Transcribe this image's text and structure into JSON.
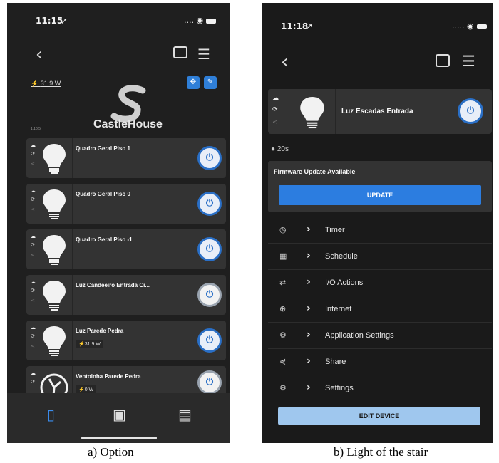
{
  "phone_a": {
    "status_time": "11:15",
    "status_right": "....",
    "power_reading": "31.9 W",
    "logo_text": "CastleHouse",
    "version": "1.10.5",
    "devices": [
      {
        "name": "Quadro Geral Piso 1",
        "watt": "",
        "state": "on"
      },
      {
        "name": "Quadro Geral Piso 0",
        "watt": "",
        "state": "on"
      },
      {
        "name": "Quadro Geral Piso -1",
        "watt": "",
        "state": "on"
      },
      {
        "name": "Luz Candeeiro Entrada Ci...",
        "watt": "",
        "state": "off"
      },
      {
        "name": "Luz Parede Pedra",
        "watt": "31.9 W",
        "state": "on"
      },
      {
        "name": "Ventoinha Parede Pedra",
        "watt": "0 W",
        "state": "off"
      }
    ],
    "caption": "a) Option"
  },
  "phone_b": {
    "status_time": "11:18",
    "status_right": ".....",
    "device_name": "Luz Escadas Entrada",
    "timer_value": "20s",
    "firmware_label": "Firmware Update Available",
    "update_label": "UPDATE",
    "menu": [
      {
        "label": "Timer",
        "icon": "clock-icon"
      },
      {
        "label": "Schedule",
        "icon": "calendar-icon"
      },
      {
        "label": "I/O Actions",
        "icon": "arrows-icon"
      },
      {
        "label": "Internet",
        "icon": "globe-icon"
      },
      {
        "label": "Application Settings",
        "icon": "app-settings-icon"
      },
      {
        "label": "Share",
        "icon": "share-icon"
      },
      {
        "label": "Settings",
        "icon": "gear-icon"
      }
    ],
    "edit_label": "EDIT DEVICE",
    "caption": "b) Light of the stair"
  },
  "colors": {
    "accent": "#2c7de0",
    "card": "#333333",
    "background": "#1b1b1b",
    "edit_button": "#9fc7ee"
  }
}
